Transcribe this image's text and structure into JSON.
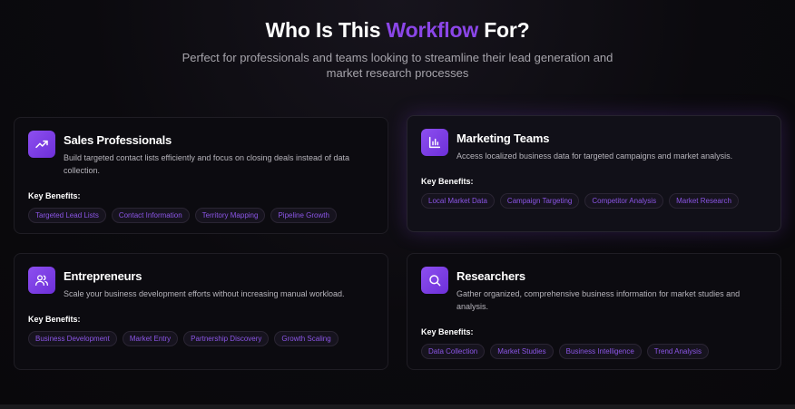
{
  "header": {
    "title_prefix": "Who Is This ",
    "title_accent": "Workflow",
    "title_suffix": " For?",
    "subtitle": "Perfect for professionals and teams looking to streamline their lead generation and market research processes"
  },
  "colors": {
    "accent": "#8b46e8",
    "icon_gradient_start": "#8d4ff0",
    "icon_gradient_end": "#6d2fd8",
    "tag_text": "#8b55e6"
  },
  "cards": [
    {
      "icon": "trending-up-icon",
      "title": "Sales Professionals",
      "description": "Build targeted contact lists efficiently and focus on closing deals instead of data collection.",
      "benefits_label": "Key Benefits:",
      "tags": [
        "Targeted Lead Lists",
        "Contact Information",
        "Territory Mapping",
        "Pipeline Growth"
      ]
    },
    {
      "icon": "bar-chart-icon",
      "title": "Marketing Teams",
      "description": "Access localized business data for targeted campaigns and market analysis.",
      "benefits_label": "Key Benefits:",
      "tags": [
        "Local Market Data",
        "Campaign Targeting",
        "Competitor Analysis",
        "Market Research"
      ]
    },
    {
      "icon": "users-icon",
      "title": "Entrepreneurs",
      "description": "Scale your business development efforts without increasing manual workload.",
      "benefits_label": "Key Benefits:",
      "tags": [
        "Business Development",
        "Market Entry",
        "Partnership Discovery",
        "Growth Scaling"
      ]
    },
    {
      "icon": "search-icon",
      "title": "Researchers",
      "description": "Gather organized, comprehensive business information for market studies and analysis.",
      "benefits_label": "Key Benefits:",
      "tags": [
        "Data Collection",
        "Market Studies",
        "Business Intelligence",
        "Trend Analysis"
      ]
    }
  ]
}
